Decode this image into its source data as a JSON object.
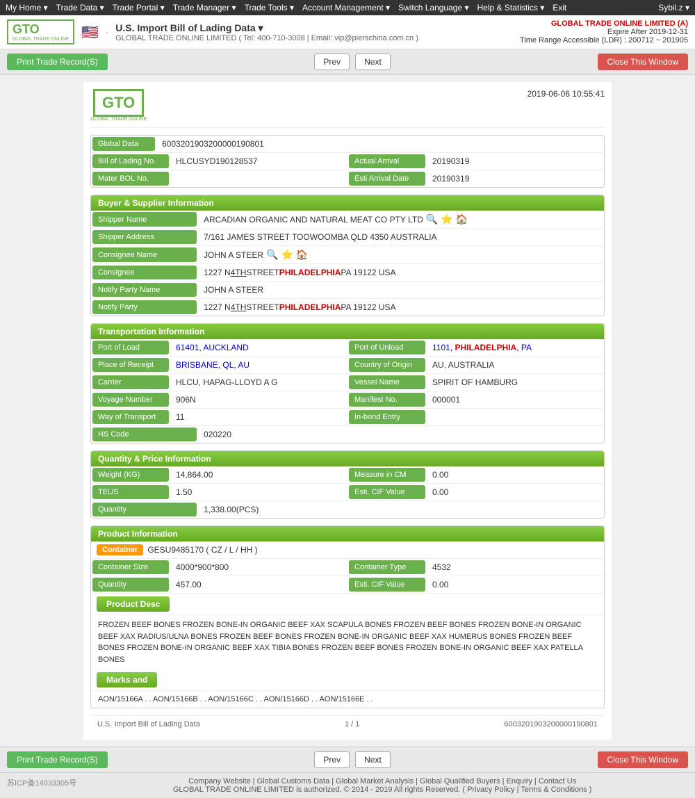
{
  "nav": {
    "items": [
      "My Home ▾",
      "Trade Data ▾",
      "Trade Portal ▾",
      "Trade Manager ▾",
      "Trade Tools ▾",
      "Account Management ▾",
      "Switch Language ▾",
      "Help & Statistics ▾",
      "Exit"
    ],
    "user": "Sybil.z ▾"
  },
  "header": {
    "logo_text": "GTO",
    "logo_sub": "GLOBAL TRADE ONLINE",
    "flag": "🇺🇸",
    "data_source_title": "U.S. Import Bill of Lading Data  ▾",
    "data_source_info": "GLOBAL TRADE ONLINE LIMITED ( Tel: 400-710-3008 | Email: vip@pierschina.com.cn )",
    "company": "GLOBAL TRADE ONLINE LIMITED (A)",
    "expire": "Expire After 2019-12-31",
    "time_range": "Time Range Accessible (LDR) : 200712 ~ 201905"
  },
  "toolbar": {
    "print_label": "Print Trade Record(S)",
    "prev_label": "Prev",
    "next_label": "Next",
    "close_label": "Close This Window"
  },
  "doc": {
    "timestamp": "2019-06-06 10:55:41",
    "global_data_label": "Global Data",
    "global_data_value": "60032019032000001908​01",
    "bol_label": "Bill of Lading No.",
    "bol_value": "HLCUSYD190128537",
    "actual_arrival_label": "Actual Arrival",
    "actual_arrival_value": "20190319",
    "master_bol_label": "Mater BOL No.",
    "master_bol_value": "",
    "esti_arrival_label": "Esti Arrival Date",
    "esti_arrival_value": "20190319"
  },
  "buyer_supplier": {
    "section_title": "Buyer & Supplier Information",
    "shipper_name_label": "Shipper Name",
    "shipper_name_value": "ARCADIAN ORGANIC AND NATURAL MEAT CO PTY LTD",
    "shipper_address_label": "Shipper Address",
    "shipper_address_value": "7/161 JAMES STREET TOOWOOMBA QLD 4350 AUSTRALIA",
    "consignee_name_label": "Consignee Name",
    "consignee_name_value": "JOHN A STEER",
    "consignee_label": "Consignee",
    "consignee_value": "1227 N 4TH STREET PHILADELPHIA PA 19122 USA",
    "notify_party_name_label": "Notify Party Name",
    "notify_party_name_value": "JOHN A STEER",
    "notify_party_label": "Notify Party",
    "notify_party_value": "1227 N 4TH STREET PHILADELPHIA PA 19122 USA"
  },
  "transport": {
    "section_title": "Transportation Information",
    "port_of_load_label": "Port of Load",
    "port_of_load_value": "61401, AUCKLAND",
    "port_of_unload_label": "Port of Unload",
    "port_of_unload_value": "1101, PHILADELPHIA, PA",
    "place_of_receipt_label": "Place of Receipt",
    "place_of_receipt_value": "BRISBANE, QL, AU",
    "country_of_origin_label": "Country of Origin",
    "country_of_origin_value": "AU, AUSTRALIA",
    "carrier_label": "Carrier",
    "carrier_value": "HLCU, HAPAG-LLOYD A G",
    "vessel_name_label": "Vessel Name",
    "vessel_name_value": "SPIRIT OF HAMBURG",
    "voyage_number_label": "Voyage Number",
    "voyage_number_value": "906N",
    "manifest_no_label": "Manifest No.",
    "manifest_no_value": "000001",
    "way_of_transport_label": "Way of Transport",
    "way_of_transport_value": "11",
    "in_bond_entry_label": "In-bond Entry",
    "in_bond_entry_value": "",
    "hs_code_label": "HS Code",
    "hs_code_value": "020220"
  },
  "quantity_price": {
    "section_title": "Quantity & Price Information",
    "weight_label": "Weight (KG)",
    "weight_value": "14,864.00",
    "measure_cm_label": "Measure in CM",
    "measure_cm_value": "0.00",
    "teus_label": "TEUS",
    "teus_value": "1.50",
    "esti_cif_label": "Esti. CIF Value",
    "esti_cif_value": "0.00",
    "quantity_label": "Quantity",
    "quantity_value": "1,338.00(PCS)"
  },
  "product": {
    "section_title": "Product Information",
    "container_tag": "Container",
    "container_value": "GESU9485170 ( CZ / L / HH )",
    "container_size_label": "Container Size",
    "container_size_value": "4000*900*800",
    "container_type_label": "Container Type",
    "container_type_value": "4532",
    "quantity_label": "Quantity",
    "quantity_value": "457.00",
    "esti_cif_label": "Esti. CIF Value",
    "esti_cif_value": "0.00",
    "product_desc_label": "Product Desc",
    "product_desc_value": "FROZEN BEEF BONES FROZEN BONE-IN ORGANIC BEEF XAX SCAPULA BONES FROZEN BEEF BONES FROZEN BONE-IN ORGANIC BEEF XAX RADIUS/ULNA BONES FROZEN BEEF BONES FROZEN BONE-IN ORGANIC BEEF XAX HUMERUS BONES FROZEN BEEF BONES FROZEN BONE-IN ORGANIC BEEF XAX TIBIA BONES FROZEN BEEF BONES FROZEN BONE-IN ORGANIC BEEF XAX PATELLA BONES",
    "marks_label": "Marks and",
    "marks_value": "AON/15166A . . AON/15166B . . AON/15166C . . AON/15166D . . AON/15166E . ."
  },
  "doc_footer": {
    "source": "U.S. Import Bill of Lading Data",
    "page": "1 / 1",
    "record_id": "60032019032000001908​01"
  },
  "site_footer": {
    "icp": "苏ICP备14033305号",
    "links": "Company Website | Global Customs Data | Global Market Analysis | Global Qualified Buyers | Enquiry | Contact Us",
    "copyright": "GLOBAL TRADE ONLINE LIMITED is authorized. © 2014 - 2019 All rights Reserved.  ( Privacy Policy | Terms & Conditions )"
  }
}
